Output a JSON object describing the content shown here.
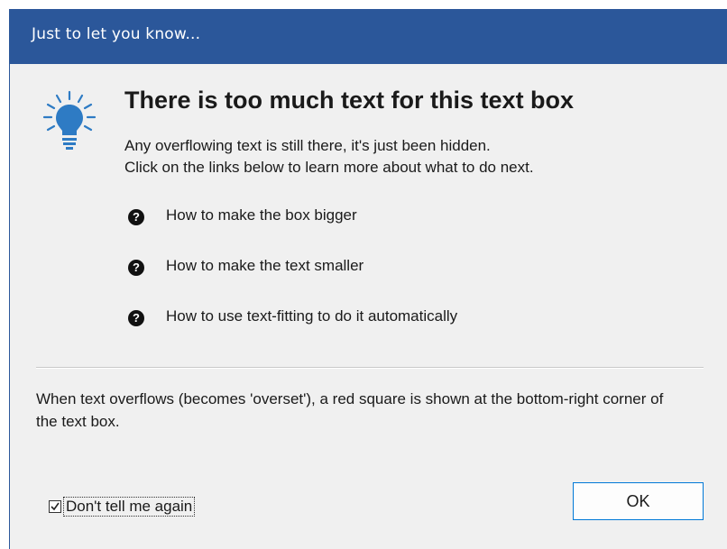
{
  "dialog": {
    "title": "Just to let you know...",
    "heading": "There is too much text for this text box",
    "description_line1": "Any overflowing text is still there, it's just been hidden.",
    "description_line2": "Click on the links below to learn more about what to do next.",
    "icon": "lightbulb-icon"
  },
  "links": [
    {
      "label": "How to make the box bigger",
      "icon": "help-icon"
    },
    {
      "label": "How to make the text smaller",
      "icon": "help-icon"
    },
    {
      "label": "How to use text-fitting to do it automatically",
      "icon": "help-icon"
    }
  ],
  "help_glyph": "?",
  "note": "When text overflows (becomes 'overset'), a red square is shown at the bottom-right corner of the text box.",
  "checkbox": {
    "label": "Don't tell me again",
    "checked": true
  },
  "ok_button": {
    "label": "OK"
  },
  "colors": {
    "titlebar": "#2b579a",
    "bulb": "#2e7bc4",
    "button_border": "#0078d7",
    "background": "#f0f0f0"
  }
}
